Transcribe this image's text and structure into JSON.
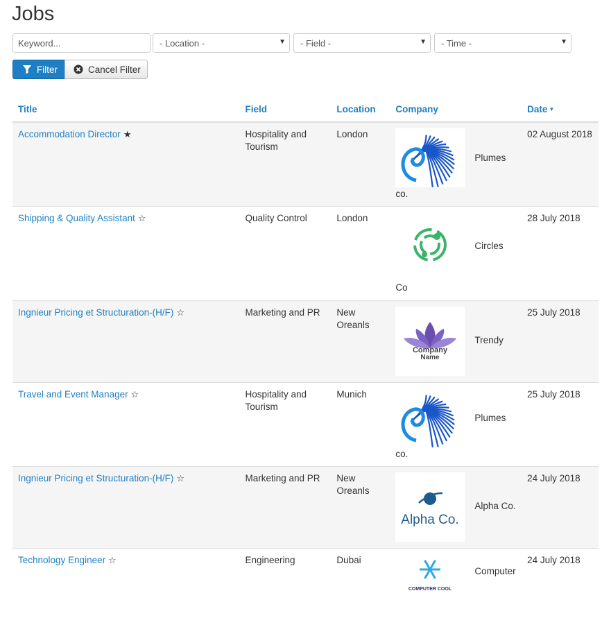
{
  "page": {
    "title": "Jobs"
  },
  "filters": {
    "keyword_placeholder": "Keyword...",
    "location": "- Location -",
    "field": "- Field -",
    "time": "- Time -",
    "filter_label": "Filter",
    "cancel_label": "Cancel Filter"
  },
  "table": {
    "headers": {
      "title": "Title",
      "field": "Field",
      "location": "Location",
      "company": "Company",
      "date": "Date"
    },
    "rows": [
      {
        "title": "Accommodation Director",
        "starred": true,
        "field": "Hospitality and Tourism",
        "location": "London",
        "logo": "plumes-logo",
        "company_name": "Plumes",
        "company_suffix": "co.",
        "date": "02 August 2018"
      },
      {
        "title": "Shipping & Quality Assistant",
        "starred": false,
        "field": "Quality Control",
        "location": "London",
        "logo": "circles-logo",
        "company_name": "Circles",
        "company_suffix": "Co",
        "date": "28 July 2018"
      },
      {
        "title": "Ingnieur Pricing et Structuration-(H/F)",
        "starred": false,
        "field": "Marketing and PR",
        "location": "New Oreanls",
        "logo": "trendy-logo",
        "logo_text": "Company Name",
        "company_name": "Trendy",
        "company_suffix": "",
        "date": "25 July 2018"
      },
      {
        "title": "Travel and Event Manager",
        "starred": false,
        "field": "Hospitality and Tourism",
        "location": "Munich",
        "logo": "plumes-logo",
        "company_name": "Plumes",
        "company_suffix": "co.",
        "date": "25 July 2018"
      },
      {
        "title": "Ingnieur Pricing et Structuration-(H/F)",
        "starred": false,
        "field": "Marketing and PR",
        "location": "New Oreanls",
        "logo": "alpha-logo",
        "logo_text": "Alpha Co.",
        "company_name": "Alpha Co.",
        "company_suffix": "",
        "date": "24 July 2018"
      },
      {
        "title": "Technology Engineer",
        "starred": false,
        "field": "Engineering",
        "location": "Dubai",
        "logo": "computer-cool-logo",
        "logo_text": "COMPUTER COOL",
        "company_name": "Computer",
        "company_suffix": "",
        "date": "24 July 2018"
      }
    ]
  },
  "colors": {
    "accent": "#1f7fc4",
    "stripe": "#f5f5f5"
  }
}
